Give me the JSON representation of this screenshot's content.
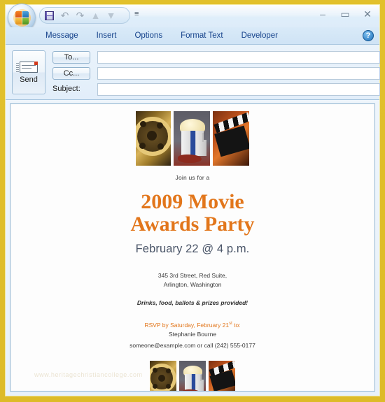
{
  "window": {
    "controls": {
      "minimize": "–",
      "maximize": "▭",
      "close": "✕"
    },
    "quick_access": {
      "save": "save-icon",
      "undo": "↶",
      "redo": "↷",
      "previous": "▲",
      "next": "▼",
      "customize": "≡"
    },
    "office_button": "office-orb"
  },
  "ribbon": {
    "tabs": [
      {
        "label": "Message"
      },
      {
        "label": "Insert"
      },
      {
        "label": "Options"
      },
      {
        "label": "Format Text"
      },
      {
        "label": "Developer"
      }
    ],
    "help_label": "?"
  },
  "compose": {
    "send_label": "Send",
    "to_label": "To...",
    "cc_label": "Cc...",
    "subject_label": "Subject:",
    "to_value": "",
    "cc_value": "",
    "subject_value": "",
    "to_placeholder": "",
    "cc_placeholder": "",
    "subject_placeholder": ""
  },
  "invitation": {
    "join_text": "Join us for a",
    "title_line1": "2009 Movie",
    "title_line2": "Awards Party",
    "date_time": "February 22 @ 4 p.m.",
    "address_line1": "345 3rd Street, Red Suite,",
    "address_line2": "Arlington, Washington",
    "provided_text": "Drinks, food, ballots & prizes provided!",
    "rsvp_prefix": "RSVP by Saturday, February 21",
    "rsvp_ordinal": "st",
    "rsvp_suffix": " to:",
    "contact_name": "Stephanie Bourne",
    "contact_details": "someone@example.com or call (242) 555-0177",
    "watermark": "www.heritagechristiancollege.com",
    "images_top": [
      {
        "name": "film-reel-image"
      },
      {
        "name": "popcorn-image"
      },
      {
        "name": "clapperboard-image"
      }
    ],
    "images_bottom": [
      {
        "name": "film-reel-image"
      },
      {
        "name": "popcorn-image"
      },
      {
        "name": "clapperboard-image"
      }
    ]
  },
  "colors": {
    "frame_gold": "#e0bf2a",
    "title_orange": "#e2761b",
    "date_slate": "#4a5568",
    "tab_blue": "#15428b",
    "body_border": "#8fb3d0"
  }
}
